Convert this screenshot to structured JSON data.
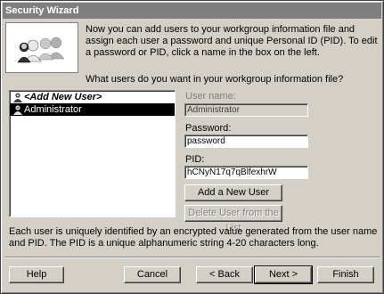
{
  "window": {
    "title": "Security Wizard"
  },
  "intro": {
    "text": "Now you can add users to your workgroup information file and assign each user a password and unique Personal ID (PID). To edit a password or PID, click a name in the box on the left.",
    "question": "What users do you want in your workgroup information file?"
  },
  "users": {
    "items": [
      {
        "label": "<Add New User>",
        "icon": "user-icon"
      },
      {
        "label": "Administrator",
        "icon": "user-icon"
      }
    ],
    "selected": "Administrator"
  },
  "form": {
    "username_label": "User name:",
    "username_value": "Administrator",
    "password_label": "Password:",
    "password_value": "password",
    "pid_label": "PID:",
    "pid_value": "hCNyN17q7qBlfexhrW",
    "add_button": "Add a New User",
    "delete_button": "Delete User from the List"
  },
  "footer": {
    "note": "Each user is uniquely identified by an encrypted value generated from the user name and PID. The PID is a unique alphanumeric string 4-20 characters long.",
    "help": "Help",
    "cancel": "Cancel",
    "back": "< Back",
    "next": "Next >",
    "finish": "Finish"
  },
  "colors": {
    "dialog_bg": "#d4d0c8",
    "titlebar_bg": "#7f7f7f",
    "selection_bg": "#000000"
  }
}
